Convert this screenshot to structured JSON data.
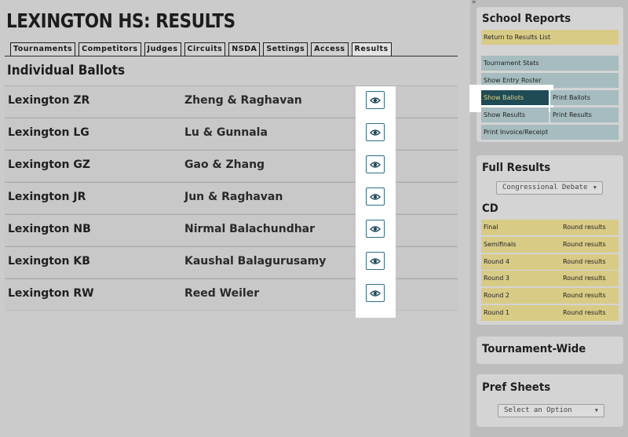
{
  "page": {
    "title": "LEXINGTON HS: RESULTS"
  },
  "tabs": [
    "Tournaments",
    "Competitors",
    "Judges",
    "Circuits",
    "NSDA",
    "Settings",
    "Access",
    "Results"
  ],
  "section": {
    "title": "Individual Ballots"
  },
  "ballots": [
    {
      "entry": "Lexington ZR",
      "names": "Zheng & Raghavan"
    },
    {
      "entry": "Lexington LG",
      "names": "Lu & Gunnala"
    },
    {
      "entry": "Lexington GZ",
      "names": "Gao & Zhang"
    },
    {
      "entry": "Lexington JR",
      "names": "Jun & Raghavan"
    },
    {
      "entry": "Lexington NB",
      "names": "Nirmal Balachundhar"
    },
    {
      "entry": "Lexington KB",
      "names": "Kaushal Balagurusamy"
    },
    {
      "entry": "Lexington RW",
      "names": "Reed Weiler"
    }
  ],
  "sidebar": {
    "collapse_glyph": "»",
    "school_reports": {
      "title": "School Reports",
      "return_link": "Return to Results List",
      "tournament_stats": "Tournament Stats",
      "show_entry_roster": "Show Entry Roster",
      "show_ballots": "Show Ballots",
      "print_ballots": "Print Ballots",
      "show_results": "Show Results",
      "print_results": "Print Results",
      "print_invoice": "Print Invoice/Receipt"
    },
    "full_results": {
      "title": "Full Results",
      "selected_event": "Congressional Debate",
      "event_code": "CD",
      "rounds": [
        {
          "label": "Final",
          "link": "Round results"
        },
        {
          "label": "Semifinals",
          "link": "Round results"
        },
        {
          "label": "Round 4",
          "link": "Round results"
        },
        {
          "label": "Round 3",
          "link": "Round results"
        },
        {
          "label": "Round 2",
          "link": "Round results"
        },
        {
          "label": "Round 1",
          "link": "Round results"
        }
      ]
    },
    "tournament_wide": {
      "title": "Tournament-Wide"
    },
    "pref_sheets": {
      "title": "Pref Sheets",
      "placeholder": "Select an Option"
    }
  },
  "colors": {
    "gold": "#d8cb86",
    "teal": "#a6bcbf",
    "dark_teal": "#1f4b57",
    "icon_blue": "#2f6f85"
  },
  "icons": {
    "view": "eye-icon",
    "select": "caret-down-icon"
  }
}
